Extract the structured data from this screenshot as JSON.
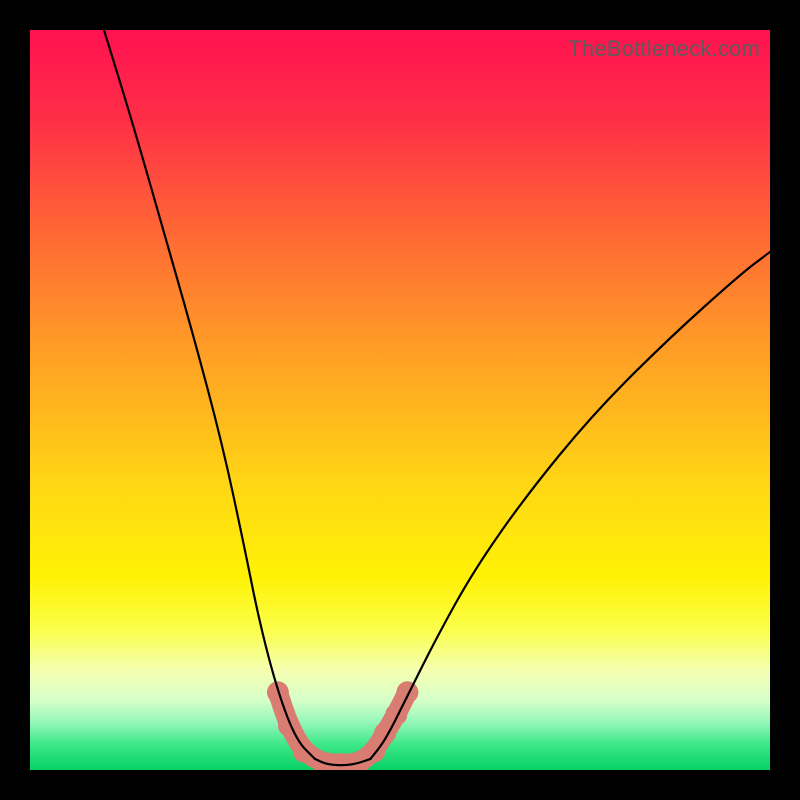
{
  "watermark": "TheBottleneck.com",
  "chart_data": {
    "type": "line",
    "title": "",
    "xlabel": "",
    "ylabel": "",
    "xlim": [
      0,
      100
    ],
    "ylim": [
      0,
      100
    ],
    "grid": false,
    "note": "Axes are unlabeled; values are percentage estimates read from pixel positions within the plotting area.",
    "series": [
      {
        "name": "left-branch",
        "x": [
          10,
          14,
          18,
          22,
          26,
          29,
          31,
          33.5,
          36,
          38.5
        ],
        "y": [
          100,
          87,
          73,
          59,
          44,
          30,
          20,
          10.5,
          4,
          1.5
        ]
      },
      {
        "name": "right-branch",
        "x": [
          46,
          48,
          51,
          55,
          60,
          67,
          76,
          86,
          96,
          100
        ],
        "y": [
          1.5,
          4,
          10,
          18,
          27,
          37,
          48,
          58,
          67,
          70
        ]
      },
      {
        "name": "valley-floor",
        "x": [
          38.5,
          40,
          42,
          44,
          46
        ],
        "y": [
          1.5,
          0.8,
          0.6,
          0.8,
          1.5
        ]
      }
    ],
    "markers": {
      "name": "highlighted-points",
      "color": "#d97c72",
      "points": [
        {
          "x": 33.5,
          "y": 10.5
        },
        {
          "x": 35.0,
          "y": 6.0
        },
        {
          "x": 37.0,
          "y": 2.5
        },
        {
          "x": 39.5,
          "y": 1.0
        },
        {
          "x": 42.0,
          "y": 0.8
        },
        {
          "x": 44.5,
          "y": 1.0
        },
        {
          "x": 46.5,
          "y": 2.5
        },
        {
          "x": 48.0,
          "y": 5.0
        },
        {
          "x": 49.5,
          "y": 7.5
        },
        {
          "x": 51.0,
          "y": 10.5
        }
      ]
    },
    "gradient_stops": [
      {
        "pos": 0.0,
        "color": "#ff1250"
      },
      {
        "pos": 0.12,
        "color": "#ff2e47"
      },
      {
        "pos": 0.28,
        "color": "#ff6a34"
      },
      {
        "pos": 0.45,
        "color": "#ffa324"
      },
      {
        "pos": 0.62,
        "color": "#ffd814"
      },
      {
        "pos": 0.74,
        "color": "#fff205"
      },
      {
        "pos": 0.81,
        "color": "#fbff4a"
      },
      {
        "pos": 0.865,
        "color": "#f4ffb0"
      },
      {
        "pos": 0.905,
        "color": "#d7ffc8"
      },
      {
        "pos": 0.935,
        "color": "#96f7ba"
      },
      {
        "pos": 0.965,
        "color": "#3de889"
      },
      {
        "pos": 1.0,
        "color": "#06d164"
      }
    ]
  }
}
